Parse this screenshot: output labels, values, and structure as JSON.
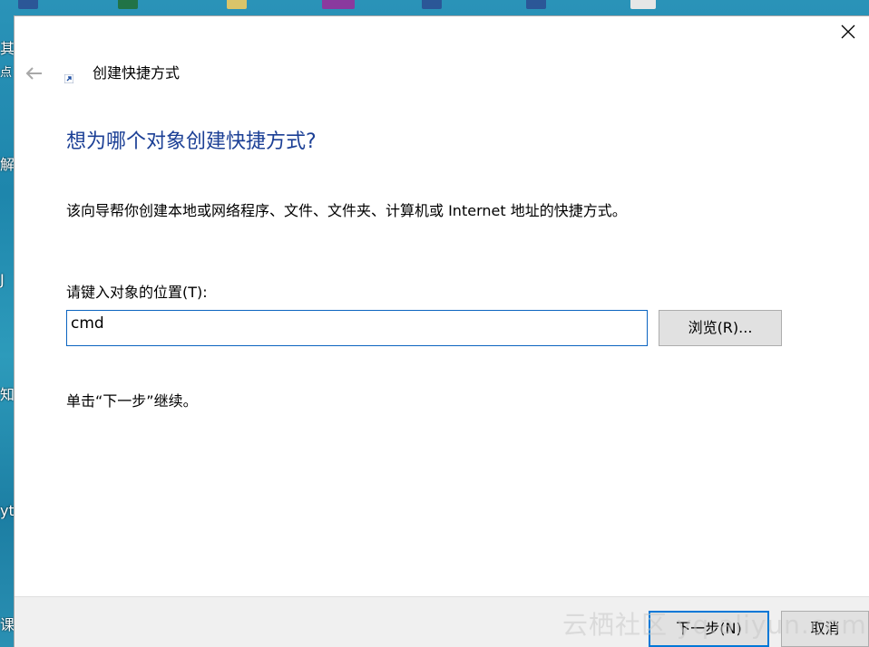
{
  "desktop": {
    "side_chars": [
      "其",
      "点",
      "解",
      "J",
      "知",
      "yt",
      "课"
    ],
    "icons": [
      {
        "color": "#2b5797"
      },
      {
        "color": "#217346"
      },
      {
        "color": "#d9c46a"
      },
      {
        "color": "#8a3a9e"
      },
      {
        "color": "#2b5797"
      },
      {
        "color": "#2b5797"
      },
      {
        "color": "#e6e6e6"
      }
    ]
  },
  "dialog": {
    "window_title": "创建快捷方式",
    "heading": "想为哪个对象创建快捷方式?",
    "description": "该向导帮你创建本地或网络程序、文件、文件夹、计算机或 Internet 地址的快捷方式。",
    "location_label": "请键入对象的位置(T):",
    "location_value": "cmd",
    "browse_label": "浏览(R)...",
    "continue_text": "单击“下一步”继续。",
    "next_label": "下一步(N)",
    "cancel_label": "取消"
  },
  "watermark": "云栖社区 yq.aliyun.com",
  "colors": {
    "heading": "#1b3f95",
    "input_border": "#0b64c0",
    "primary_border": "#0078d7",
    "button_bg": "#e1e1e1",
    "footer_bg": "#f0f0f0"
  }
}
